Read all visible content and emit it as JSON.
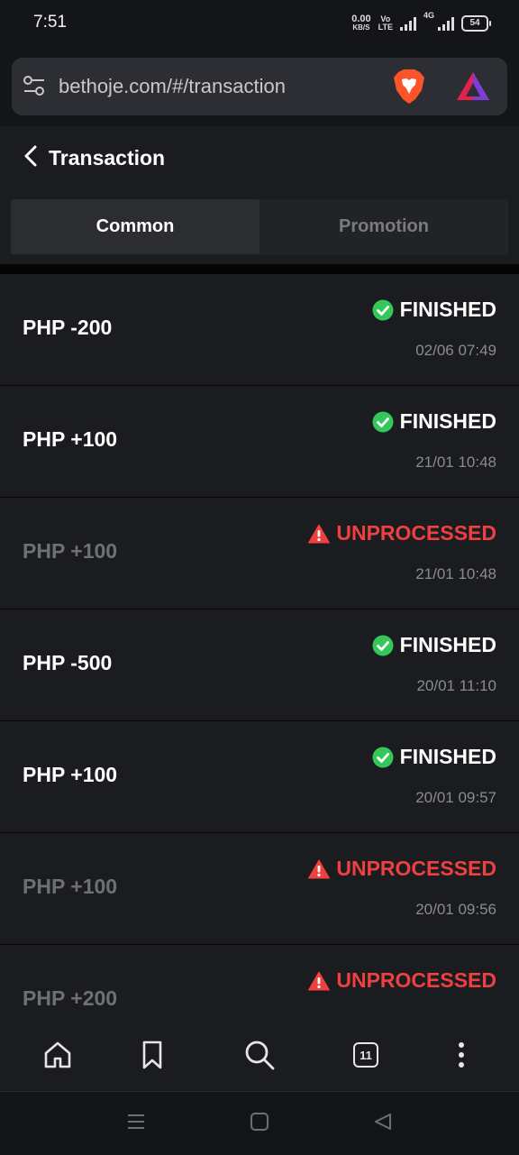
{
  "status_bar": {
    "time": "7:51",
    "net_speed": "0.00",
    "net_unit": "KB/S",
    "volte_top": "Vo",
    "volte_bottom": "LTE",
    "network": "4G",
    "battery": "54"
  },
  "browser": {
    "url": "bethoje.com/#/transaction",
    "icons": [
      "tune-icon",
      "brave-lion-icon",
      "brave-rewards-icon"
    ]
  },
  "page": {
    "title": "Transaction",
    "tabs": [
      {
        "label": "Common",
        "active": true
      },
      {
        "label": "Promotion",
        "active": false
      }
    ]
  },
  "transactions": [
    {
      "amount": "PHP -200",
      "status": "FINISHED",
      "kind": "ok",
      "date": "02/06 07:49"
    },
    {
      "amount": "PHP +100",
      "status": "FINISHED",
      "kind": "ok",
      "date": "21/01 10:48"
    },
    {
      "amount": "PHP +100",
      "status": "UNPROCESSED",
      "kind": "warn",
      "date": "21/01 10:48"
    },
    {
      "amount": "PHP -500",
      "status": "FINISHED",
      "kind": "ok",
      "date": "20/01 11:10"
    },
    {
      "amount": "PHP +100",
      "status": "FINISHED",
      "kind": "ok",
      "date": "20/01 09:57"
    },
    {
      "amount": "PHP +100",
      "status": "UNPROCESSED",
      "kind": "warn",
      "date": "20/01 09:56"
    },
    {
      "amount": "PHP +200",
      "status": "UNPROCESSED",
      "kind": "warn",
      "date": ""
    }
  ],
  "bottom_nav": {
    "tab_count": "11"
  },
  "colors": {
    "success": "#34c759",
    "warning": "#ef4040",
    "background": "#1b1c20"
  }
}
